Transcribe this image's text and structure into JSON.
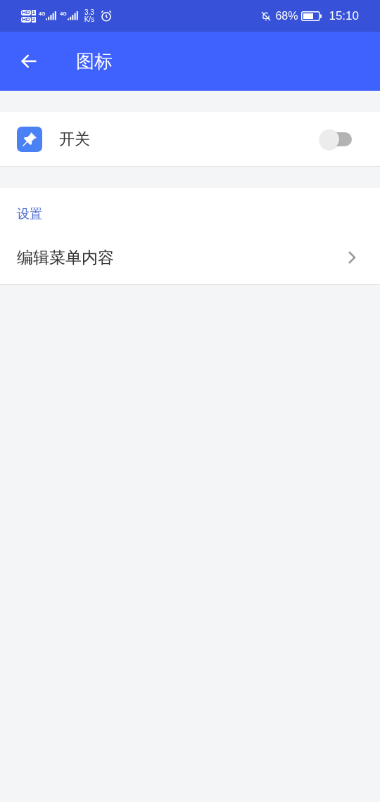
{
  "status_bar": {
    "sims": [
      {
        "label": "HD",
        "slot": "1"
      },
      {
        "label": "HD",
        "slot": "2"
      }
    ],
    "networks": [
      "4G",
      "4G"
    ],
    "speed": [
      "3.3",
      "K/s"
    ],
    "battery": "68%",
    "time": "15:10"
  },
  "app_bar": {
    "title": "图标"
  },
  "switch_row": {
    "label": "开关",
    "on": false
  },
  "section": {
    "header": "设置",
    "items": [
      {
        "label": "编辑菜单内容"
      }
    ]
  }
}
